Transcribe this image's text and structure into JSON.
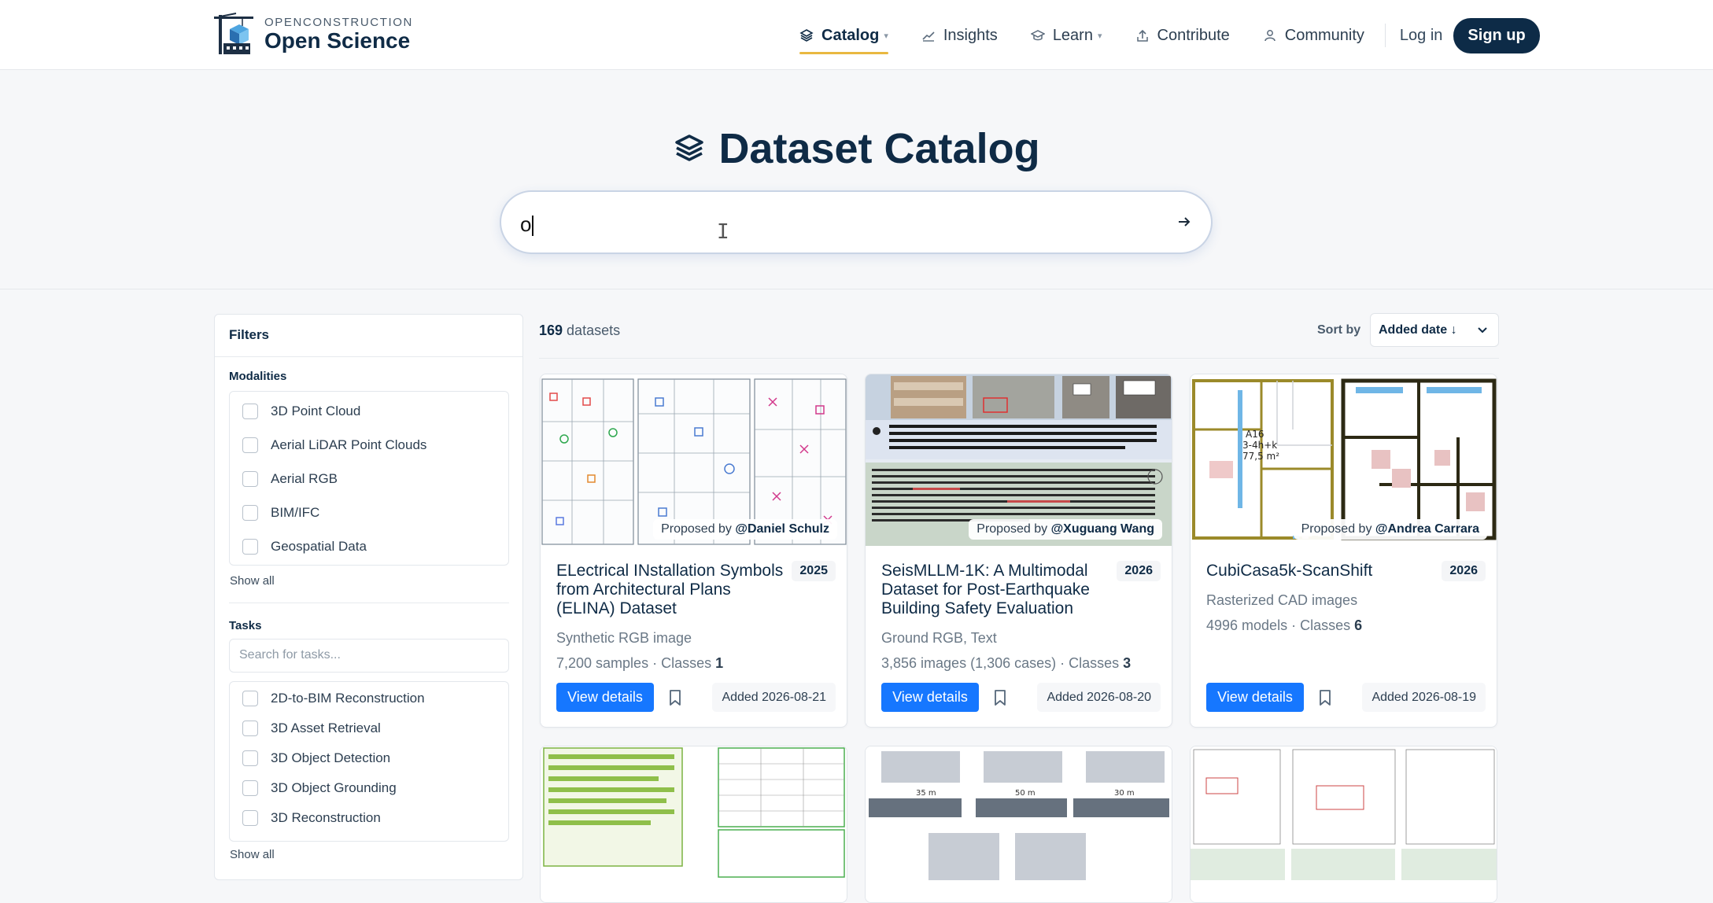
{
  "brand": {
    "top": "OPENCONSTRUCTION",
    "bottom": "Open Science"
  },
  "nav": {
    "items": [
      {
        "label": "Catalog",
        "icon": "layers-icon",
        "dropdown": true,
        "active": true
      },
      {
        "label": "Insights",
        "icon": "chart-line-icon",
        "dropdown": false
      },
      {
        "label": "Learn",
        "icon": "graduation-cap-icon",
        "dropdown": true
      },
      {
        "label": "Contribute",
        "icon": "upload-icon",
        "dropdown": false
      },
      {
        "label": "Community",
        "icon": "user-icon",
        "dropdown": false
      }
    ],
    "login": "Log in",
    "signup": "Sign up"
  },
  "hero": {
    "title": "Dataset Catalog",
    "search_value": "o"
  },
  "filters": {
    "title": "Filters",
    "modalities": {
      "title": "Modalities",
      "items": [
        "3D Point Cloud",
        "Aerial LiDAR Point Clouds",
        "Aerial RGB",
        "BIM/IFC",
        "Geospatial Data"
      ],
      "show_all": "Show all"
    },
    "tasks": {
      "title": "Tasks",
      "placeholder": "Search for tasks...",
      "items": [
        "2D-to-BIM Reconstruction",
        "3D Asset Retrieval",
        "3D Object Detection",
        "3D Object Grounding",
        "3D Reconstruction"
      ],
      "show_all": "Show all"
    }
  },
  "results": {
    "count": "169",
    "count_suffix": " datasets",
    "sort_label": "Sort by",
    "sort_value": "Added date ↓"
  },
  "cards": [
    {
      "proposed_prefix": "Proposed by ",
      "proposed_by": "@Daniel Schulz",
      "title": "ELectrical INstallation Symbols from Architectural Plans (ELINA) Dataset",
      "year": "2025",
      "modality": "Synthetic RGB image",
      "meta_text": "7,200 samples · Classes ",
      "meta_value": "1",
      "button": "View details",
      "added": "Added 2026-08-21"
    },
    {
      "proposed_prefix": "Proposed by ",
      "proposed_by": "@Xuguang Wang",
      "title": "SeisMLLM-1K: A Multimodal Dataset for Post-Earthquake Building Safety Evaluation",
      "year": "2026",
      "modality": "Ground RGB, Text",
      "meta_text": "3,856 images (1,306 cases) · Classes ",
      "meta_value": "3",
      "button": "View details",
      "added": "Added 2026-08-20"
    },
    {
      "proposed_prefix": "Proposed by ",
      "proposed_by": "@Andrea Carrara",
      "title": "CubiCasa5k-ScanShift",
      "year": "2026",
      "modality": "Rasterized CAD images",
      "meta_text": "4996 models · Classes ",
      "meta_value": "6",
      "button": "View details",
      "added": "Added 2026-08-19"
    }
  ],
  "colors": {
    "primary": "#1677ff",
    "navy": "#0d2b47",
    "accent": "#e9b840"
  }
}
